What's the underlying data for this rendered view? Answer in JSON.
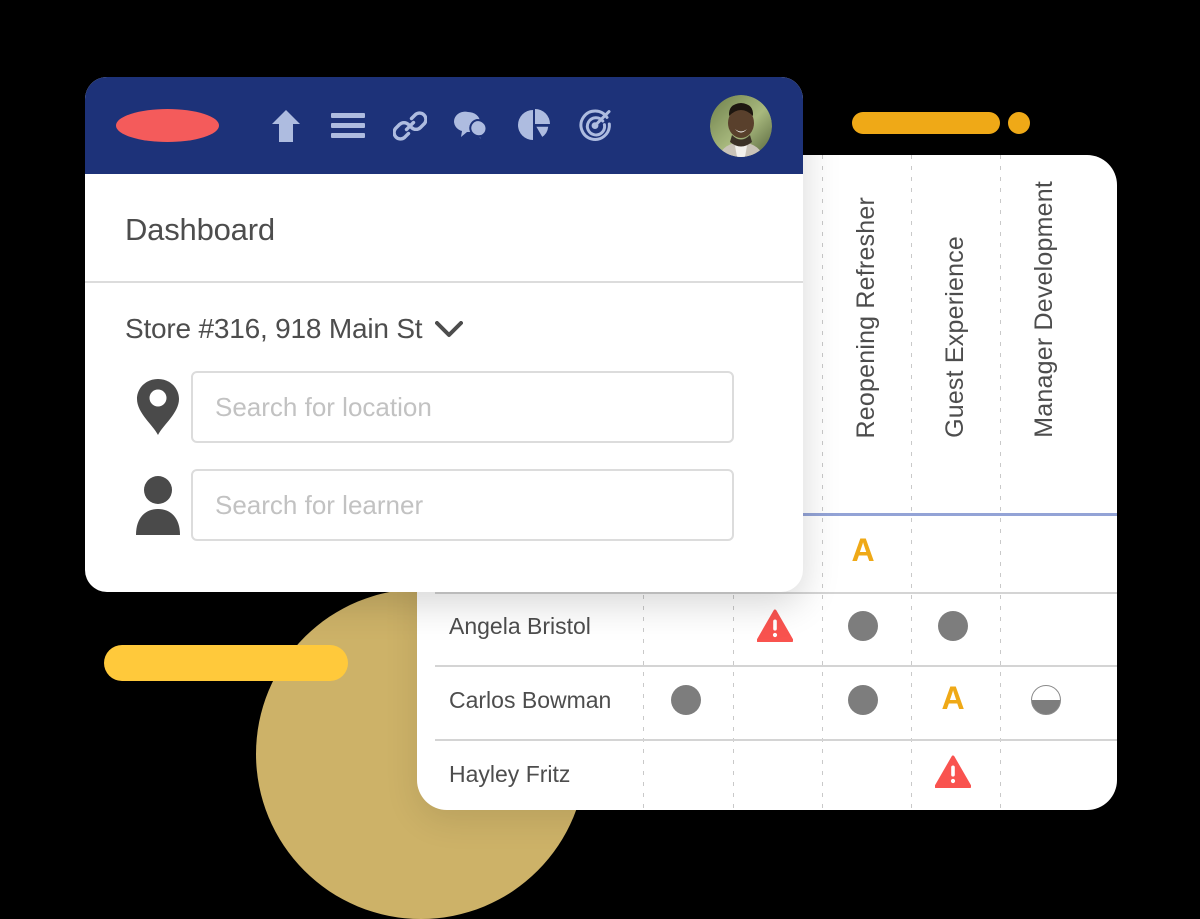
{
  "decor": {
    "circle_color": "#FAD97F",
    "pill_yellow_color": "#FFC93B",
    "pill_orange_color": "#EFA917"
  },
  "dashboard": {
    "navbar": {
      "brand": "brand-logo",
      "brand_color": "#F45B5B",
      "background_color": "#1D3279",
      "icons": [
        {
          "name": "home-up-arrow-icon",
          "label": "Home"
        },
        {
          "name": "menu-icon",
          "label": "Menu"
        },
        {
          "name": "link-icon",
          "label": "Links"
        },
        {
          "name": "chat-icon",
          "label": "Messages"
        },
        {
          "name": "pie-chart-icon",
          "label": "Reports"
        },
        {
          "name": "target-icon",
          "label": "Goals"
        }
      ],
      "avatar_alt": "User profile photo"
    },
    "page_title": "Dashboard",
    "store_selector": {
      "label": "Store #316, 918 Main St",
      "chevron": "chevron-down-icon"
    },
    "fields": [
      {
        "icon": "map-pin-icon",
        "name": "location-search",
        "placeholder": "Search for location",
        "value": ""
      },
      {
        "icon": "person-icon",
        "name": "learner-search",
        "placeholder": "Search for learner",
        "value": ""
      }
    ]
  },
  "learner_table": {
    "columns": [
      {
        "label": "",
        "key": "name"
      },
      {
        "label": "",
        "key": "col1"
      },
      {
        "label": "Reopening Refresher",
        "key": "reopening_refresher"
      },
      {
        "label": "",
        "key": "col3"
      },
      {
        "label": "Guest Experience",
        "key": "guest_experience"
      },
      {
        "label": "",
        "key": "col5"
      },
      {
        "label": "Manager Development",
        "key": "manager_development"
      }
    ],
    "header_rule_color": "#93A3D6",
    "status_legend": {
      "dot": "complete-dot",
      "half": "half-complete-dot",
      "a": "attention-letter-a",
      "warn": "overdue-warning-triangle"
    },
    "rows": [
      {
        "name": "",
        "marks": [
          {
            "col": 3,
            "type": "a",
            "label": "A"
          }
        ]
      },
      {
        "name": "Angela Bristol",
        "marks": [
          {
            "col": 2,
            "type": "warn",
            "label": ""
          },
          {
            "col": 3,
            "type": "dot",
            "label": ""
          },
          {
            "col": 4,
            "type": "dot",
            "label": ""
          }
        ]
      },
      {
        "name": "Carlos Bowman",
        "marks": [
          {
            "col": 1,
            "type": "dot",
            "label": ""
          },
          {
            "col": 3,
            "type": "dot",
            "label": ""
          },
          {
            "col": 4,
            "type": "a",
            "label": "A"
          },
          {
            "col": 5,
            "type": "half",
            "label": ""
          }
        ]
      },
      {
        "name": "Hayley Fritz",
        "marks": [
          {
            "col": 4,
            "type": "warn",
            "label": ""
          }
        ]
      }
    ]
  }
}
